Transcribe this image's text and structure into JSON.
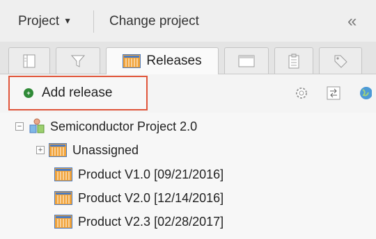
{
  "header": {
    "project_menu": "Project",
    "change_project": "Change project",
    "collapse_glyph": "«"
  },
  "tabs": [
    {
      "name": "requirements-tab",
      "icon": "requirements-icon",
      "label": ""
    },
    {
      "name": "filter-tab",
      "icon": "filter-icon",
      "label": ""
    },
    {
      "name": "releases-tab",
      "icon": "release-icon",
      "label": "Releases",
      "active": true
    },
    {
      "name": "window-tab",
      "icon": "window-icon",
      "label": ""
    },
    {
      "name": "clipboard-tab",
      "icon": "clipboard-icon",
      "label": ""
    },
    {
      "name": "tag-tab",
      "icon": "tag-icon",
      "label": ""
    }
  ],
  "toolbar": {
    "add_release": "Add release",
    "icons": [
      "settings-icon",
      "swap-icon",
      "globe-icon"
    ]
  },
  "tree": {
    "root": {
      "label": "Semiconductor Project 2.0",
      "expanded": true
    },
    "items": [
      {
        "label": "Unassigned",
        "expandable": true
      },
      {
        "label": "Product V1.0 [09/21/2016]"
      },
      {
        "label": "Product V2.0 [12/14/2016]"
      },
      {
        "label": "Product V2.3 [02/28/2017]"
      }
    ]
  },
  "colors": {
    "highlight_border": "#e0553a",
    "add_button_dot": "#2f8a37",
    "release_icon_orange": "#f1a33a",
    "release_icon_blue": "#4c7bbf"
  }
}
